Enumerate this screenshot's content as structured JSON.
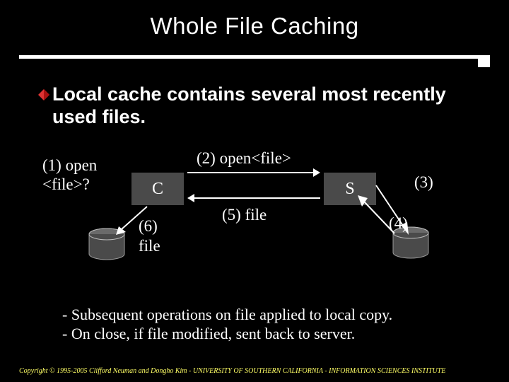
{
  "title": "Whole File Caching",
  "bullet": {
    "text": "Local cache contains several most recently used files."
  },
  "diagram": {
    "label_left": "(1) open <file>?",
    "box_c": "C",
    "box_s": "S",
    "label_top": "(2) open<file>",
    "label_mid": "(5) file",
    "label_6": "(6)",
    "label_file": "file",
    "label_3": "(3)",
    "label_4": "(4)"
  },
  "notes": {
    "line1": "- Subsequent operations on file applied to local copy.",
    "line2": "- On close, if file modified, sent back to server."
  },
  "footer": "Copyright © 1995-2005 Clifford Neuman and Dongho Kim - UNIVERSITY OF SOUTHERN CALIFORNIA - INFORMATION SCIENCES INSTITUTE",
  "colors": {
    "bg": "#000000",
    "fg": "#ffffff",
    "accent": "#ffff66",
    "box": "#4a4a4a",
    "cyl": "#5a5a5a"
  }
}
